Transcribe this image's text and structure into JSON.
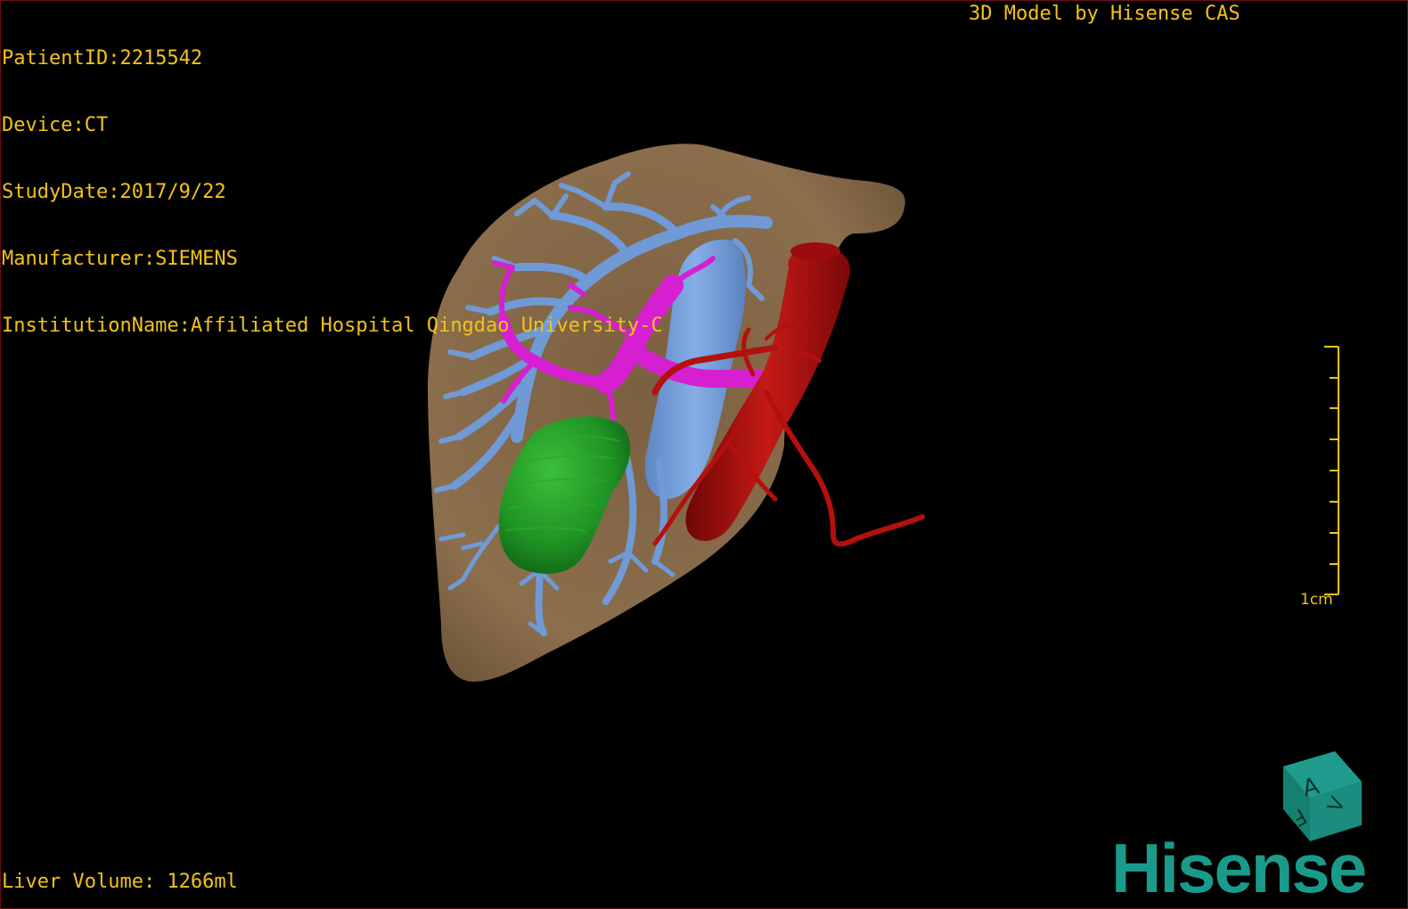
{
  "header": {
    "patient_id": "PatientID:2215542",
    "device": "Device:CT",
    "study_date": "StudyDate:2017/9/22",
    "manufacturer": "Manufacturer:SIEMENS",
    "institution": "InstitutionName:Affiliated Hospital Qingdao University-C",
    "model_credit": "3D Model by Hisense CAS"
  },
  "footer": {
    "liver_volume": "Liver Volume: 1266ml"
  },
  "scale_bar": {
    "label": "1cm"
  },
  "orientation_cube": {
    "labels": [
      "A",
      "F",
      "V"
    ]
  },
  "brand": {
    "logo_text": "Hisense"
  },
  "colors": {
    "osd_text": "#f2c21b",
    "liver": "#8b6e4b",
    "hepatic_vein": "#6f9ad6",
    "portal_vein": "#d61fd0",
    "aorta": "#b3100e",
    "lesion": "#1f9424",
    "brand": "#1a9a8a"
  }
}
